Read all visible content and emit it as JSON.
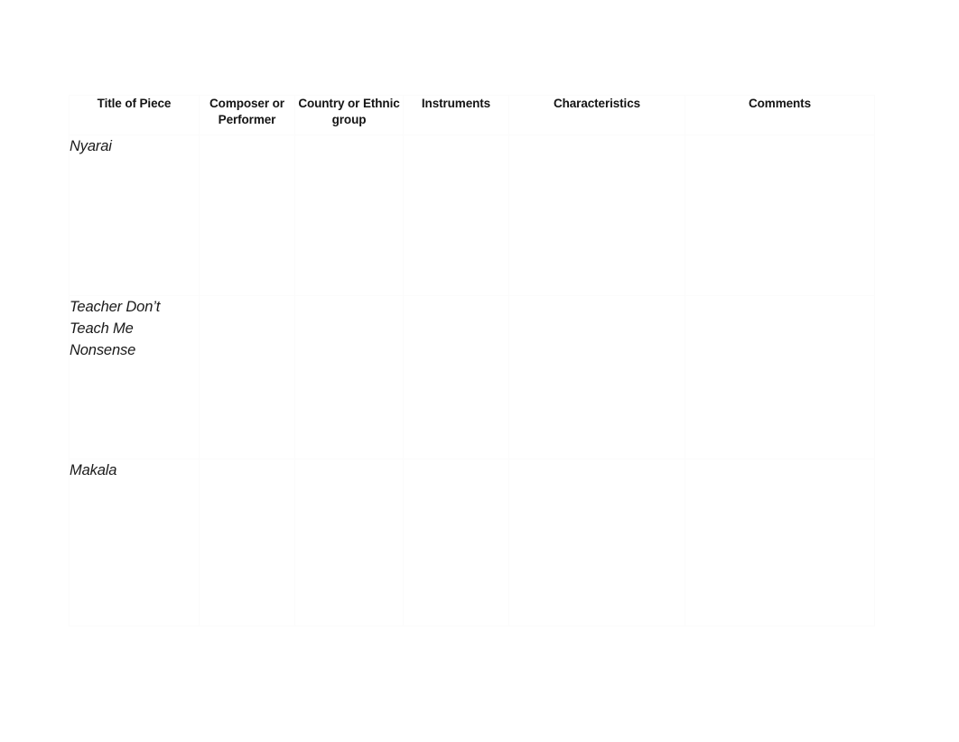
{
  "document": {
    "type": "listening-chart-worksheet",
    "background_color": "#ffffff",
    "border_color": "#fbfbfb",
    "text_color": "#151515"
  },
  "table": {
    "columns": [
      {
        "key": "title",
        "label": "Title of Piece"
      },
      {
        "key": "composer",
        "label": "Composer or Performer"
      },
      {
        "key": "country",
        "label": "Country or Ethnic group"
      },
      {
        "key": "instruments",
        "label": "Instruments"
      },
      {
        "key": "characteristics",
        "label": "Characteristics"
      },
      {
        "key": "comments",
        "label": "Comments"
      }
    ],
    "rows": [
      {
        "title": "Nyarai",
        "composer": "",
        "country": "",
        "instruments": "",
        "characteristics": "",
        "comments": ""
      },
      {
        "title": "Teacher Don’t Teach Me Nonsense",
        "composer": "",
        "country": "",
        "instruments": "",
        "characteristics": "",
        "comments": ""
      },
      {
        "title": "Makala",
        "composer": "",
        "country": "",
        "instruments": "",
        "characteristics": "",
        "comments": ""
      }
    ]
  }
}
